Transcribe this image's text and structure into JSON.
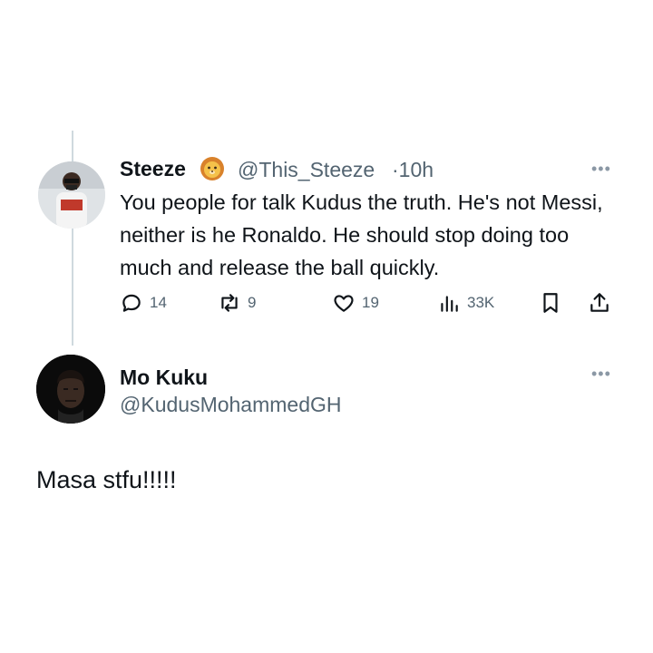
{
  "tweet1": {
    "display_name": "Steeze",
    "emoji_icon": "lion-face-icon",
    "handle": "@This_Steeze",
    "time": "·10h",
    "text": "You people for talk Kudus the truth. He's not Messi, neither is he Ronaldo. He should stop doing too much and release the ball quickly.",
    "more_label": "•••",
    "actions": {
      "reply_count": "14",
      "retweet_count": "9",
      "like_count": "19",
      "views_count": "33K"
    }
  },
  "tweet2": {
    "display_name": "Mo Kuku",
    "handle": "@KudusMohammedGH",
    "more_label": "•••",
    "text": "Masa stfu!!!!!"
  },
  "colors": {
    "text": "#0f1419",
    "secondary": "#536471",
    "thread_line": "#cfd9de"
  }
}
